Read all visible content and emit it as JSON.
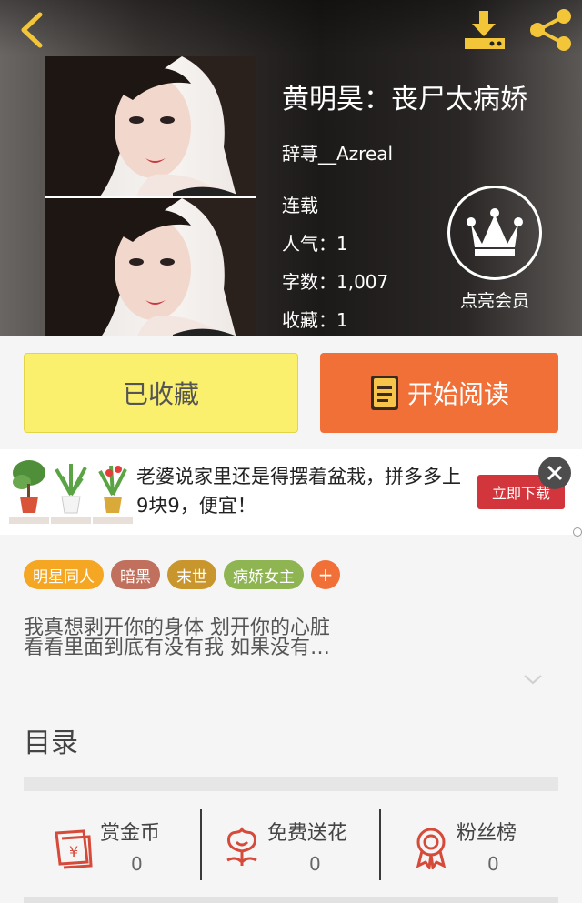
{
  "header": {
    "back_icon": "chevron-left-icon",
    "download_icon": "download-icon",
    "share_icon": "share-icon",
    "title": "黄明昊：丧尸太病娇",
    "author": "辞荨__Azreal",
    "status": "连载",
    "popularity": "人气：1",
    "word_count": "字数：1,007",
    "favorites": "收藏：1",
    "vip_label": "点亮会员",
    "vip_icon": "crown-icon"
  },
  "actions": {
    "favorited_label": "已收藏",
    "read_label": "开始阅读"
  },
  "ad": {
    "text": "老婆说家里还是得摆着盆栽，拼多多上9块9，便宜！",
    "button_label": "立即下载",
    "price_tag": "9.9"
  },
  "tags": [
    {
      "label": "明星同人",
      "color": "#f5a623"
    },
    {
      "label": "暗黑",
      "color": "#c0705c"
    },
    {
      "label": "末世",
      "color": "#c9962e"
    },
    {
      "label": "病娇女主",
      "color": "#8fb553"
    },
    {
      "label": "+",
      "color": "#f07038"
    }
  ],
  "intro": {
    "line1": "我真想剥开你的身体  划开你的心脏",
    "line2": "看看里面到底有没有我   如果没有…"
  },
  "toc_label": "目录",
  "stats": [
    {
      "label": "赏金币",
      "value": "0",
      "icon": "red-envelope-yen-icon"
    },
    {
      "label": "免费送花",
      "value": "0",
      "icon": "flower-icon"
    },
    {
      "label": "粉丝榜",
      "value": "0",
      "icon": "medal-icon"
    }
  ],
  "colors": {
    "accent_orange": "#f07038",
    "fav_yellow": "#faf06e",
    "icon_red": "#d64a3a",
    "ad_button": "#d2353b"
  }
}
